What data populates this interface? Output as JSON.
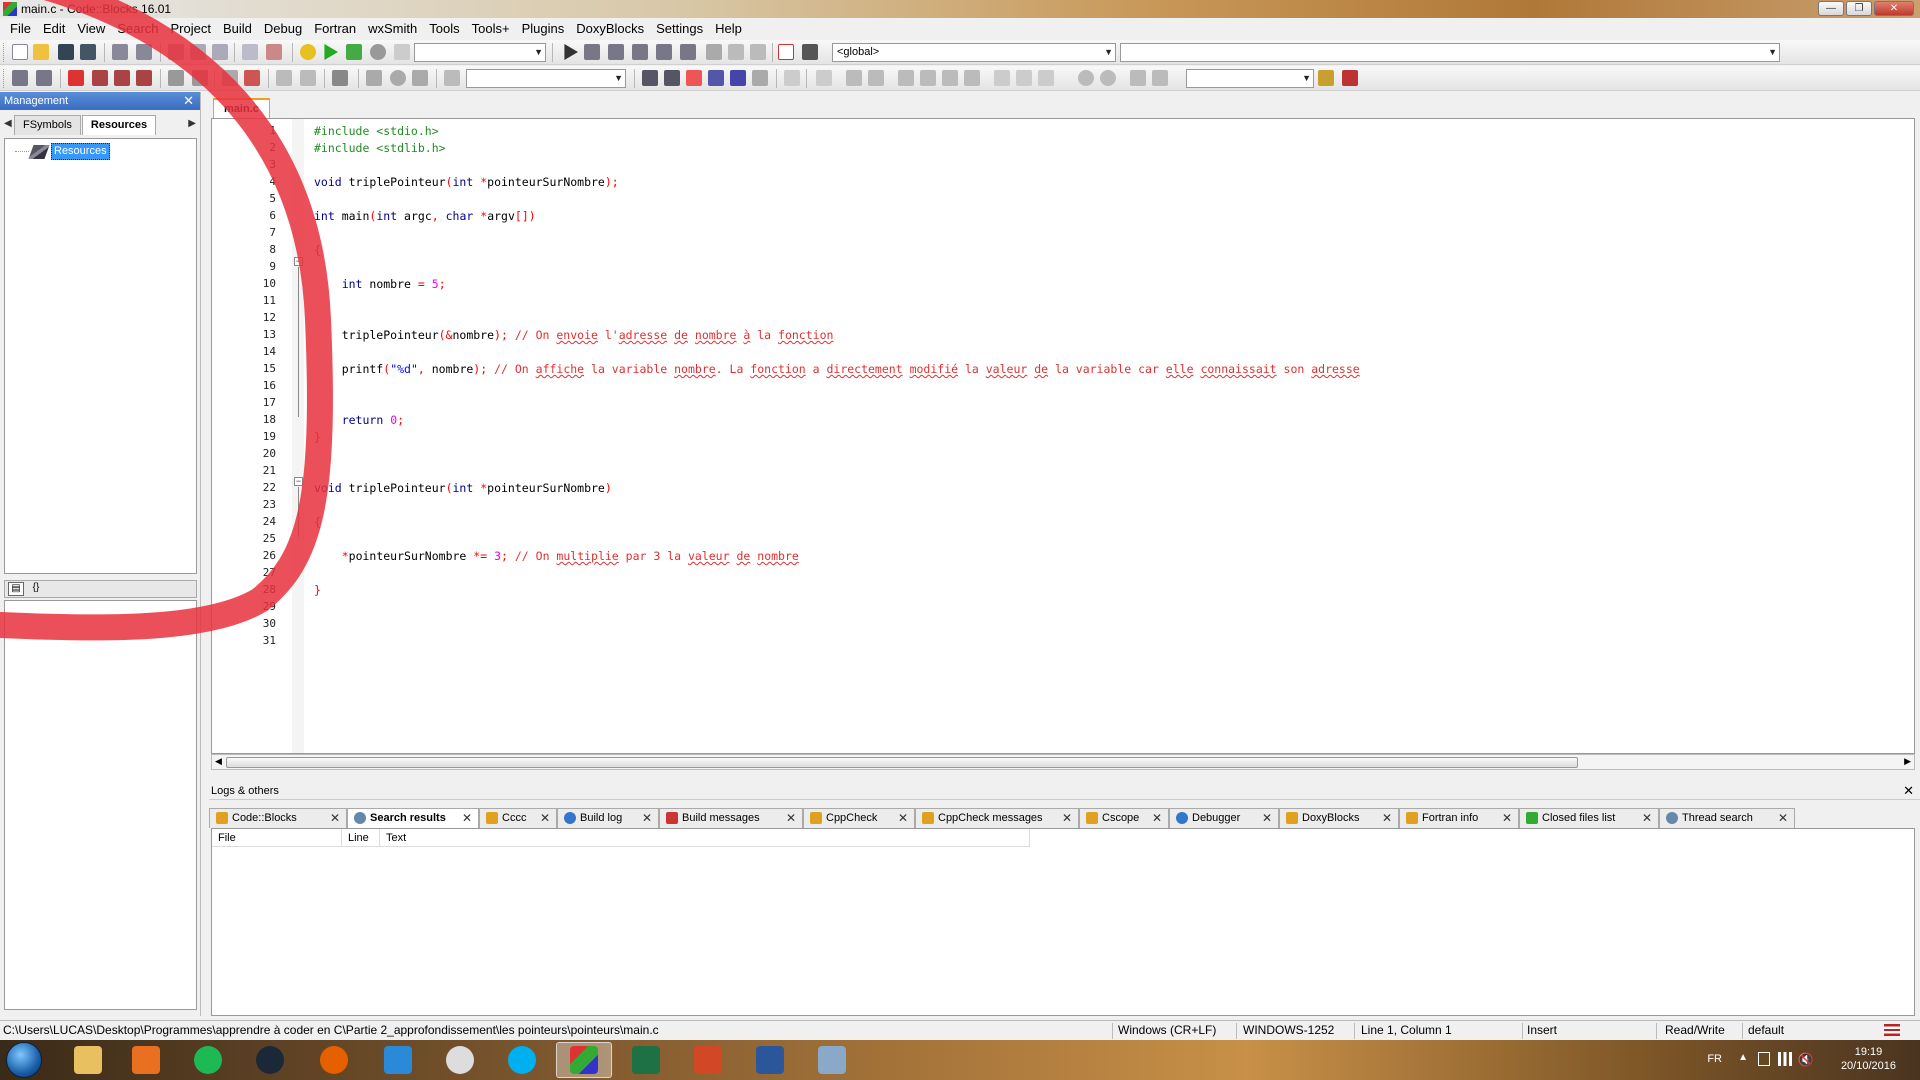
{
  "window": {
    "title": "main.c - Code::Blocks 16.01"
  },
  "menu": [
    "File",
    "Edit",
    "View",
    "Search",
    "Project",
    "Build",
    "Debug",
    "Fortran",
    "wxSmith",
    "Tools",
    "Tools+",
    "Plugins",
    "DoxyBlocks",
    "Settings",
    "Help"
  ],
  "toolbar": {
    "scope_combo": "<global>",
    "symbol_combo": "",
    "build_target_combo": "",
    "search_combo": "",
    "find_combo": ""
  },
  "management": {
    "title": "Management",
    "tabs": [
      "FSymbols",
      "Resources"
    ],
    "active_tab": "Resources",
    "tree_root": "Resources",
    "lower_icons": [
      "▤",
      "{}"
    ]
  },
  "editor": {
    "tab": "main.c",
    "line_numbers": [
      "1",
      "2",
      "3",
      "4",
      "5",
      "6",
      "7",
      "8",
      "9",
      "10",
      "11",
      "12",
      "13",
      "14",
      "15",
      "16",
      "17",
      "18",
      "19",
      "20",
      "21",
      "22",
      "23",
      "24",
      "25",
      "26",
      "27",
      "28",
      "29",
      "30",
      "31"
    ]
  },
  "logs": {
    "title": "Logs & others",
    "tabs": [
      {
        "label": "Code::Blocks",
        "icon": "pencil-icon"
      },
      {
        "label": "Search results",
        "icon": "magnifier-icon"
      },
      {
        "label": "Cccc",
        "icon": "pencil-icon"
      },
      {
        "label": "Build log",
        "icon": "gear-icon"
      },
      {
        "label": "Build messages",
        "icon": "hammer-icon"
      },
      {
        "label": "CppCheck",
        "icon": "pencil-icon"
      },
      {
        "label": "CppCheck messages",
        "icon": "pencil-icon"
      },
      {
        "label": "Cscope",
        "icon": "pencil-icon"
      },
      {
        "label": "Debugger",
        "icon": "gear-icon"
      },
      {
        "label": "DoxyBlocks",
        "icon": "pencil-icon"
      },
      {
        "label": "Fortran info",
        "icon": "pencil-icon"
      },
      {
        "label": "Closed files list",
        "icon": "recycle-icon"
      },
      {
        "label": "Thread search",
        "icon": "magnifier-icon"
      }
    ],
    "active_tab": "Search results",
    "columns": [
      "File",
      "Line",
      "Text"
    ]
  },
  "status": {
    "path": "C:\\Users\\LUCAS\\Desktop\\Programmes\\apprendre à coder en C\\Partie 2_approfondissement\\les pointeurs\\pointeurs\\main.c",
    "eol": "Windows (CR+LF)",
    "encoding": "WINDOWS-1252",
    "position": "Line 1, Column 1",
    "mode": "Insert",
    "access": "Read/Write",
    "profile": "default"
  },
  "taskbar": {
    "apps": [
      "file-explorer",
      "media-player",
      "spotify",
      "steam",
      "firefox",
      "internet-explorer",
      "steelseries-engine",
      "skype",
      "codeblocks",
      "excel",
      "powerpoint",
      "word",
      "remote-desktop"
    ],
    "lang": "FR",
    "time": "19:19",
    "date": "20/10/2016"
  },
  "colors": {
    "keyword": "#00008b",
    "preprocessor": "#228b22",
    "comment": "#e03030",
    "number": "#f000f0",
    "annotation": "#e8303c"
  }
}
